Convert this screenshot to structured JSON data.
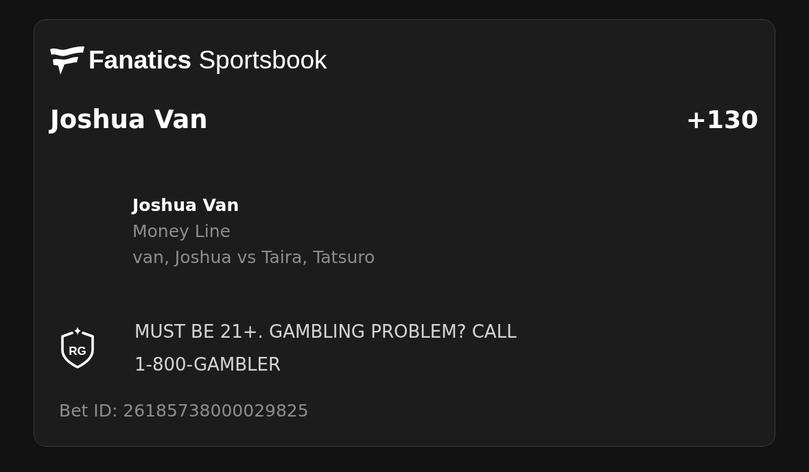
{
  "brand": {
    "name": "**Fanatics** Sportsbook"
  },
  "bet": {
    "title": "Joshua Van",
    "odds": "+130"
  },
  "selection": {
    "name": "Joshua Van",
    "market": "Money Line",
    "event": "van, Joshua vs Taira, Tatsuro"
  },
  "responsible_gaming": {
    "badge": "RG",
    "message": "MUST BE 21+. GAMBLING PROBLEM? CALL 1-800-GAMBLER"
  },
  "bet_id": "Bet ID: 26185738000029825"
}
